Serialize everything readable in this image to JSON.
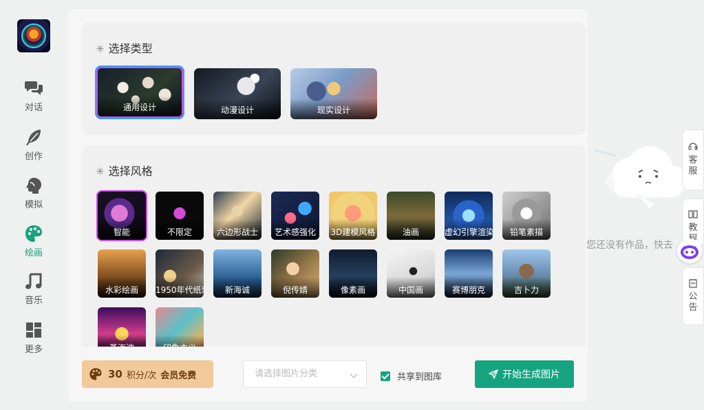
{
  "sidebar": {
    "items": [
      {
        "label": "对话",
        "icon": "chat-icon"
      },
      {
        "label": "创作",
        "icon": "feather-icon"
      },
      {
        "label": "模拟",
        "icon": "head-icon"
      },
      {
        "label": "绘画",
        "icon": "palette-icon",
        "active": true
      },
      {
        "label": "音乐",
        "icon": "music-icon"
      },
      {
        "label": "更多",
        "icon": "grid-icon"
      }
    ]
  },
  "type_section": {
    "title": "选择类型",
    "tiles": [
      {
        "label": "通用设计",
        "selected": true
      },
      {
        "label": "动漫设计"
      },
      {
        "label": "现实设计"
      }
    ]
  },
  "style_section": {
    "title": "选择风格",
    "tiles": [
      {
        "label": "智能",
        "selected": true
      },
      {
        "label": "不限定"
      },
      {
        "label": "六边形战士"
      },
      {
        "label": "艺术感强化"
      },
      {
        "label": "3D建模风格"
      },
      {
        "label": "油画"
      },
      {
        "label": "虚幻引擎渲染"
      },
      {
        "label": "铅笔素描"
      },
      {
        "label": "水彩绘画"
      },
      {
        "label": "1950年代纸浆"
      },
      {
        "label": "新海诚"
      },
      {
        "label": "倪传婧"
      },
      {
        "label": "像素画"
      },
      {
        "label": "中国画"
      },
      {
        "label": "赛博朋克"
      },
      {
        "label": "吉卜力"
      },
      {
        "label": "蒸汽波"
      },
      {
        "label": "印象主义"
      }
    ]
  },
  "bottom_bar": {
    "points_value": "30",
    "points_unit": "积分/次",
    "member_free": "会员免费",
    "category_placeholder": "请选择图片分类",
    "share_label": "共享到图库",
    "share_checked": true,
    "generate_label": "开始生成图片"
  },
  "right_panel": {
    "empty_text": "您还没有作品，快去",
    "tabs": [
      {
        "label": "客服"
      },
      {
        "label": "教程"
      },
      {
        "label": "公告"
      }
    ]
  },
  "colors": {
    "accent": "#16a37f",
    "points_bg": "#f1c99b"
  }
}
